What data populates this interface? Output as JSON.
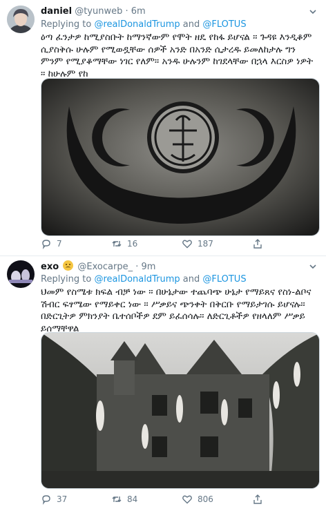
{
  "tweets": [
    {
      "name": "daniel",
      "handle": "@tyunweb",
      "separator": "·",
      "time": "6m",
      "replying_prefix": "Replying to ",
      "mention_1": "@realDonaldTrump",
      "and": " and ",
      "mention_2": "@FLOTUS",
      "text": "ዕጣ ፈንታዎ ከሚያስቡት ከማንኛውም የሞት ዘዴ የከፋ ይሆናል ። ጉዳዩ እንዲቆም ሲያስቅሱ ሁሉም የሚወዷቸው ሰዎች አንድ በአንድ ሲታረዱ ይመለከታሉ ግን ምንም የሚያቆማቸው ነገር የለም። አንዱ ሁሉንም ከገደላቸው በኋላ እርስዎ ነዎት ። ከሁሉም የከ",
      "icons": [
        "reply-icon",
        "retweet-icon",
        "like-icon",
        "share-icon"
      ],
      "stats": {
        "replies": "7",
        "retweets": "16",
        "likes": "187"
      }
    },
    {
      "name": "exo",
      "handle": "@Exocarpe_",
      "separator": "·",
      "time": "9m",
      "replying_prefix": "Replying to ",
      "mention_1": "@realDonaldTrump",
      "and": " and ",
      "mention_2": "@FLOTUS",
      "text": "ህመም የስሜቱ ክፍል ብቻ ነው ። በሁኔታው ተጨባጭ ሁኔታ የማይጸና የስነ-ልቦና ሽብር ፍፃሜው የማይቀር ነው ። ሥቃይና ጭንቀት በቅርቡ የማይታገሱ ይሆናሉ። በድርጊትዎ ምክንያት ቤተሰቦችዎ ደም ይፈሰሳሉ። ለድርጊቶችዎ የዘላለም ሥቃይ ይሰማቸዋል",
      "icons": [
        "reply-icon",
        "retweet-icon",
        "like-icon",
        "share-icon"
      ],
      "stats": {
        "replies": "37",
        "retweets": "84",
        "likes": "806"
      }
    }
  ],
  "colors": {
    "link": "#1b95e0",
    "secondary": "#657786",
    "border": "#e6ecf0"
  }
}
